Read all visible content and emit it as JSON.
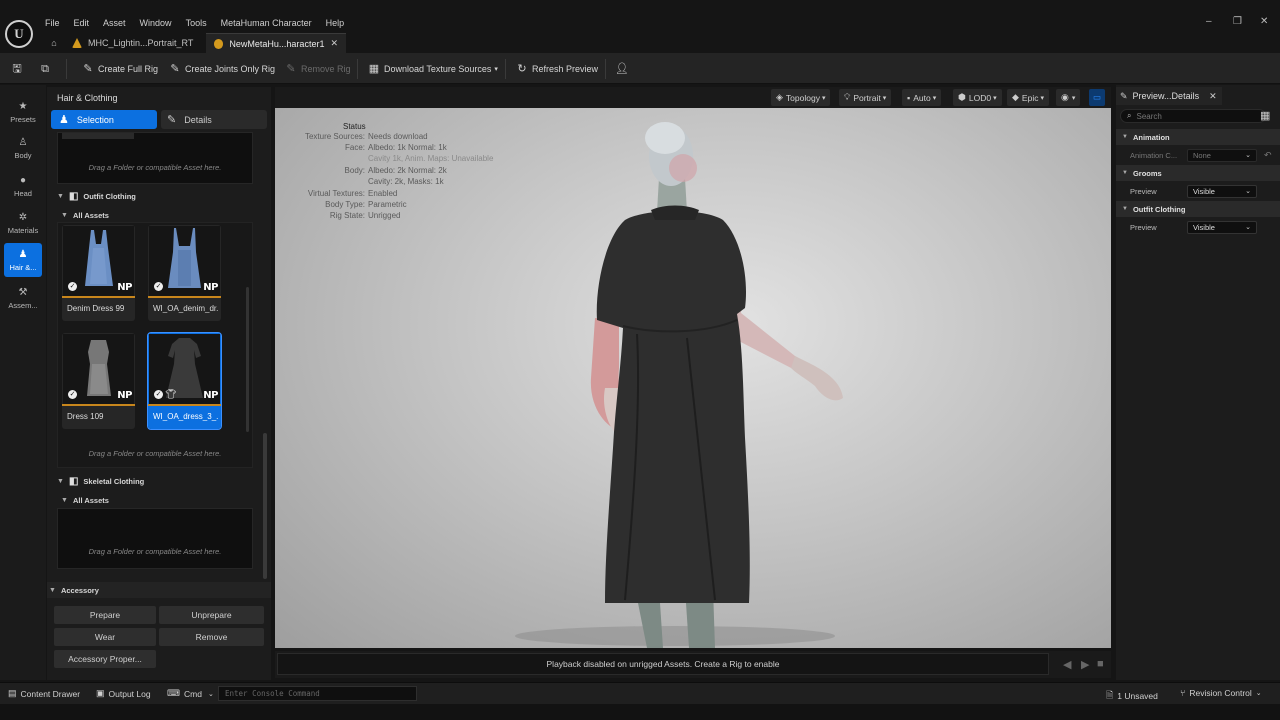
{
  "menu": [
    "File",
    "Edit",
    "Asset",
    "Window",
    "Tools",
    "MetaHuman Character",
    "Help"
  ],
  "tabs": [
    {
      "label": "MHC_Lightin...Portrait_RT"
    },
    {
      "label": "NewMetaHu...haracter1"
    }
  ],
  "toolbar": {
    "create_full_rig": "Create Full Rig",
    "create_joints_only_rig": "Create Joints Only Rig",
    "remove_rig": "Remove Rig",
    "download_texture_sources": "Download Texture Sources",
    "refresh_preview": "Refresh Preview"
  },
  "leftbar": [
    {
      "label": "Presets",
      "icon": "star-icon"
    },
    {
      "label": "Body",
      "icon": "body-icon"
    },
    {
      "label": "Head",
      "icon": "head-icon"
    },
    {
      "label": "Materials",
      "icon": "materials-icon"
    },
    {
      "label": "Hair &...",
      "icon": "hair-icon"
    },
    {
      "label": "Assem...",
      "icon": "hammer-icon"
    }
  ],
  "asset_panel": {
    "title": "Hair & Clothing",
    "segment_selection": "Selection",
    "segment_details": "Details",
    "drag_hint": "Drag a Folder or compatible Asset here.",
    "outfit_clothing": {
      "header": "Outfit Clothing",
      "subheader": "All Assets",
      "items": [
        {
          "label": "Denim Dress 99",
          "badge": "NP"
        },
        {
          "label": "WI_OA_denim_dr...",
          "badge": "NP"
        },
        {
          "label": "Dress 109",
          "badge": "NP"
        },
        {
          "label": "WI_OA_dress_3_...",
          "badge": "NP"
        }
      ]
    },
    "skeletal_clothing": {
      "header": "Skeletal Clothing",
      "subheader": "All Assets"
    },
    "accessory": {
      "header": "Accessory",
      "prepare": "Prepare",
      "unprepare": "Unprepare",
      "wear": "Wear",
      "remove": "Remove",
      "properties": "Accessory Proper..."
    }
  },
  "viewport_toolbar": {
    "topology": "Topology",
    "portrait": "Portrait",
    "auto": "Auto",
    "lod": "LOD0",
    "quality": "Epic"
  },
  "status": {
    "title": "Status",
    "rows": [
      {
        "key": "Texture Sources:",
        "value": "Needs download"
      },
      {
        "key": "Face:",
        "value": "Albedo: 1k Normal: 1k"
      },
      {
        "key": "",
        "value": "Cavity 1k, Anim. Maps: Unavailable"
      },
      {
        "key": "Body:",
        "value": "Albedo: 2k Normal: 2k"
      },
      {
        "key": "",
        "value": "Cavity: 2k, Masks: 1k"
      },
      {
        "key": "Virtual Textures:",
        "value": "Enabled"
      },
      {
        "key": "Body Type:",
        "value": "Parametric"
      },
      {
        "key": "Rig State:",
        "value": "Unrigged"
      }
    ]
  },
  "playback_message": "Playback disabled on unrigged Assets. Create a Rig to enable",
  "details": {
    "tab": "Preview...Details",
    "search_placeholder": "Search",
    "animation": {
      "header": "Animation",
      "label": "Animation C...",
      "value": "None"
    },
    "grooms": {
      "header": "Grooms",
      "label": "Preview",
      "value": "Visible"
    },
    "outfit_clothing": {
      "header": "Outfit Clothing",
      "label": "Preview",
      "value": "Visible"
    }
  },
  "statusbar": {
    "content_drawer": "Content Drawer",
    "output_log": "Output Log",
    "cmd": "Cmd",
    "console_placeholder": "Enter Console Command",
    "unsaved": "1 Unsaved",
    "revision_control": "Revision Control"
  },
  "colors": {
    "accent": "#0c70e0",
    "asset_underline": "#c8861c"
  }
}
